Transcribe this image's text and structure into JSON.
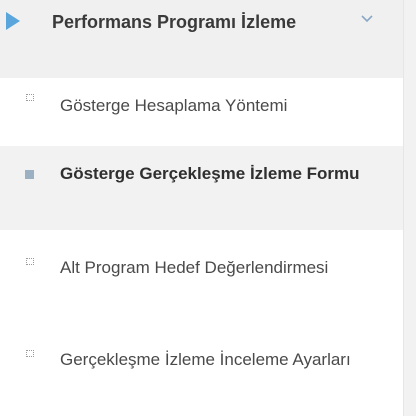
{
  "menu": {
    "group": {
      "title": "Performans Programı İzleme",
      "expanded": true,
      "arrow_color": "#5aa6dc"
    },
    "items": [
      {
        "label": "Gösterge Hesaplama Yöntemi",
        "active": false,
        "bullet": "dotted-square-icon"
      },
      {
        "label": "Gösterge Gerçekleşme İzleme Formu",
        "active": true,
        "bullet": "solid-square-icon"
      },
      {
        "label": "Alt Program Hedef Değerlendirmesi",
        "active": false,
        "bullet": "dotted-square-icon"
      },
      {
        "label": "Gerçekleşme İzleme İnceleme Ayarları",
        "active": false,
        "bullet": "dotted-square-icon"
      }
    ]
  }
}
